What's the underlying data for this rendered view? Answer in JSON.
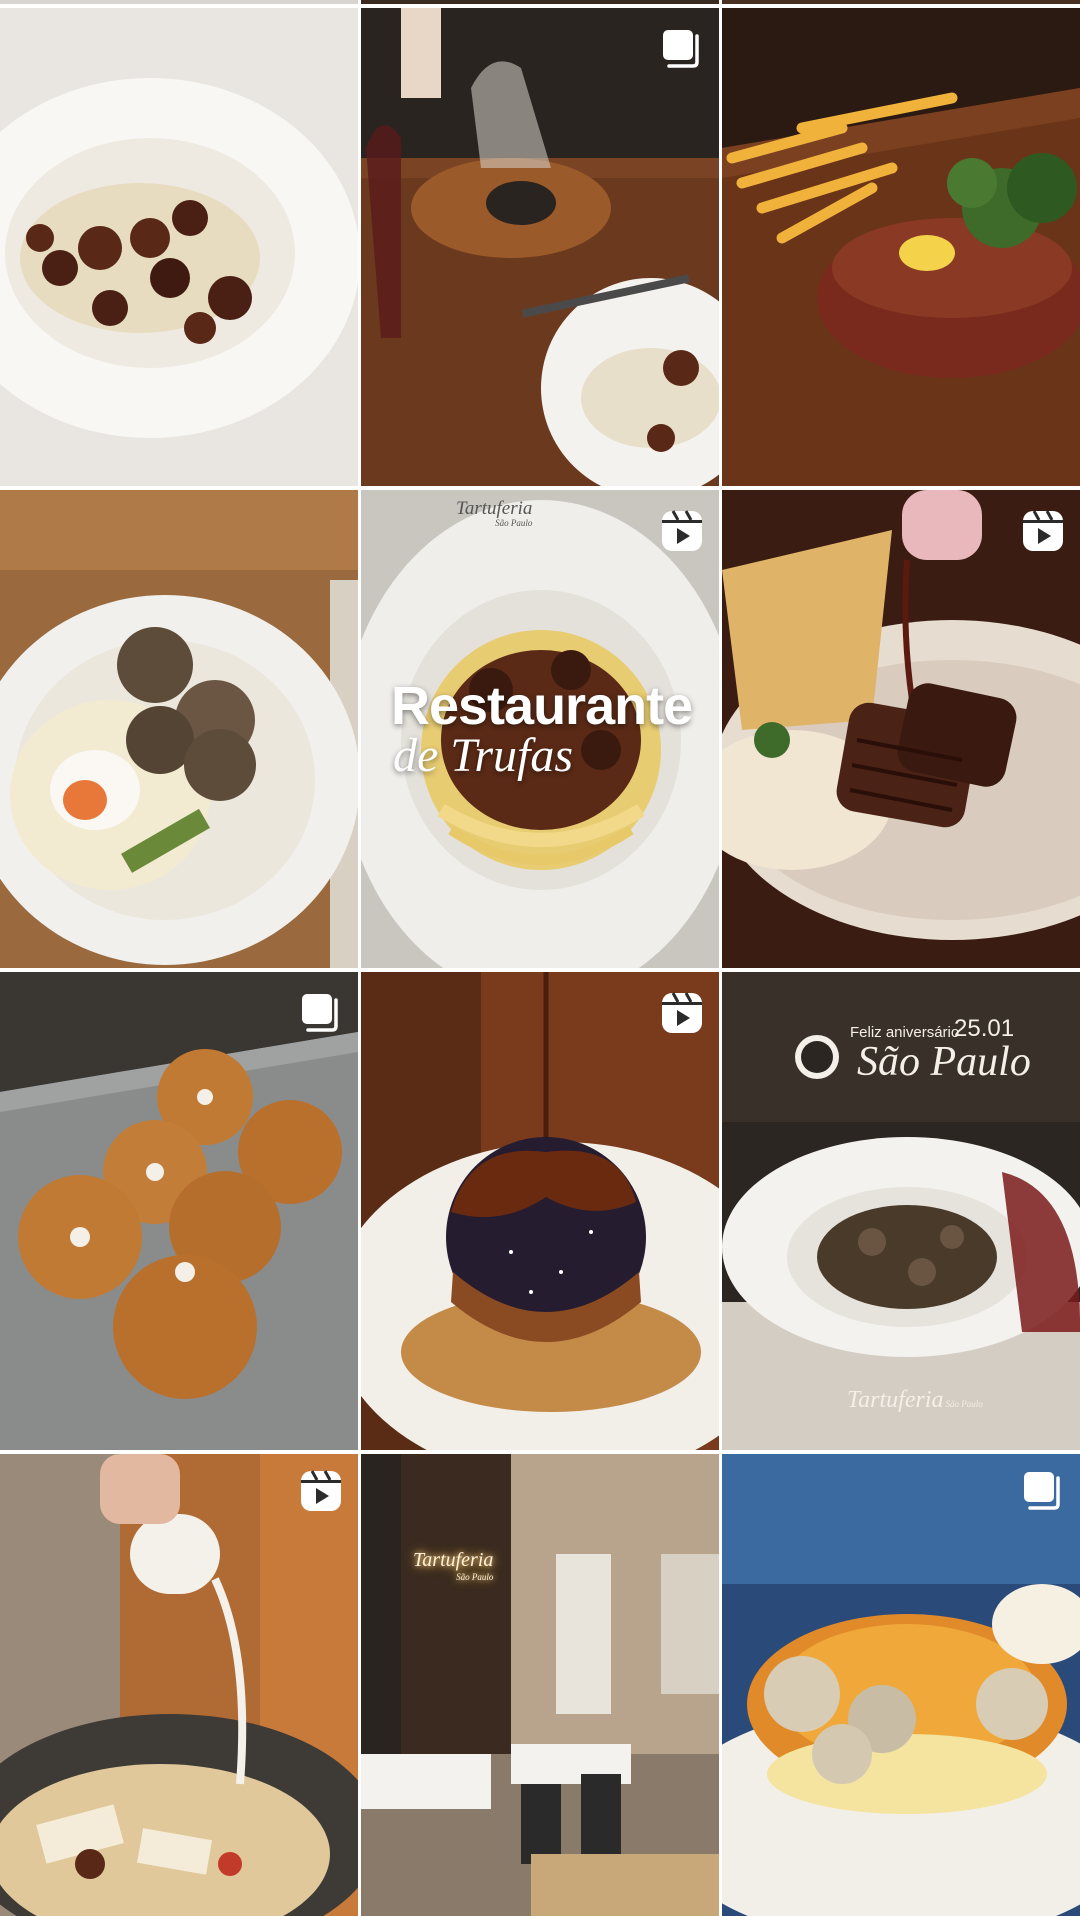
{
  "screen": {
    "description_hidden": false
  },
  "posts": [
    {
      "type": "carousel",
      "content": "photo",
      "icon": "carousel-icon"
    },
    {
      "type": "carousel",
      "content": "photo",
      "icon": "carousel-icon"
    },
    {
      "type": "carousel",
      "content": "photo",
      "icon": "carousel-icon"
    },
    {
      "type": "image",
      "content": "photo"
    },
    {
      "type": "reel",
      "content": "photo",
      "icon": "reel-icon"
    },
    {
      "type": "reel",
      "content": "photo",
      "icon": "reel-icon"
    },
    {
      "type": "carousel",
      "content": "photo",
      "icon": "carousel-icon"
    },
    {
      "type": "reel",
      "content": "photo",
      "icon": "reel-icon"
    },
    {
      "type": "image",
      "content": "photo"
    },
    {
      "type": "reel",
      "content": "photo",
      "icon": "reel-icon"
    },
    {
      "type": "image",
      "content": "photo"
    },
    {
      "type": "carousel",
      "content": "photo",
      "icon": "carousel-icon"
    }
  ],
  "overlays": {
    "restaurant_title": "Restaurante",
    "restaurant_subtitle": "de Trufas",
    "brand_name": "Tartuferia",
    "brand_city_small": "São Paulo",
    "birthday_line": "Feliz aniversário",
    "birthday_date": "25.01",
    "birthday_city": "São Paulo",
    "neon_brand": "Tartuferia",
    "neon_city": "São Paulo"
  },
  "colors": {
    "background": "#ffffff",
    "badge": "#ffffff"
  }
}
